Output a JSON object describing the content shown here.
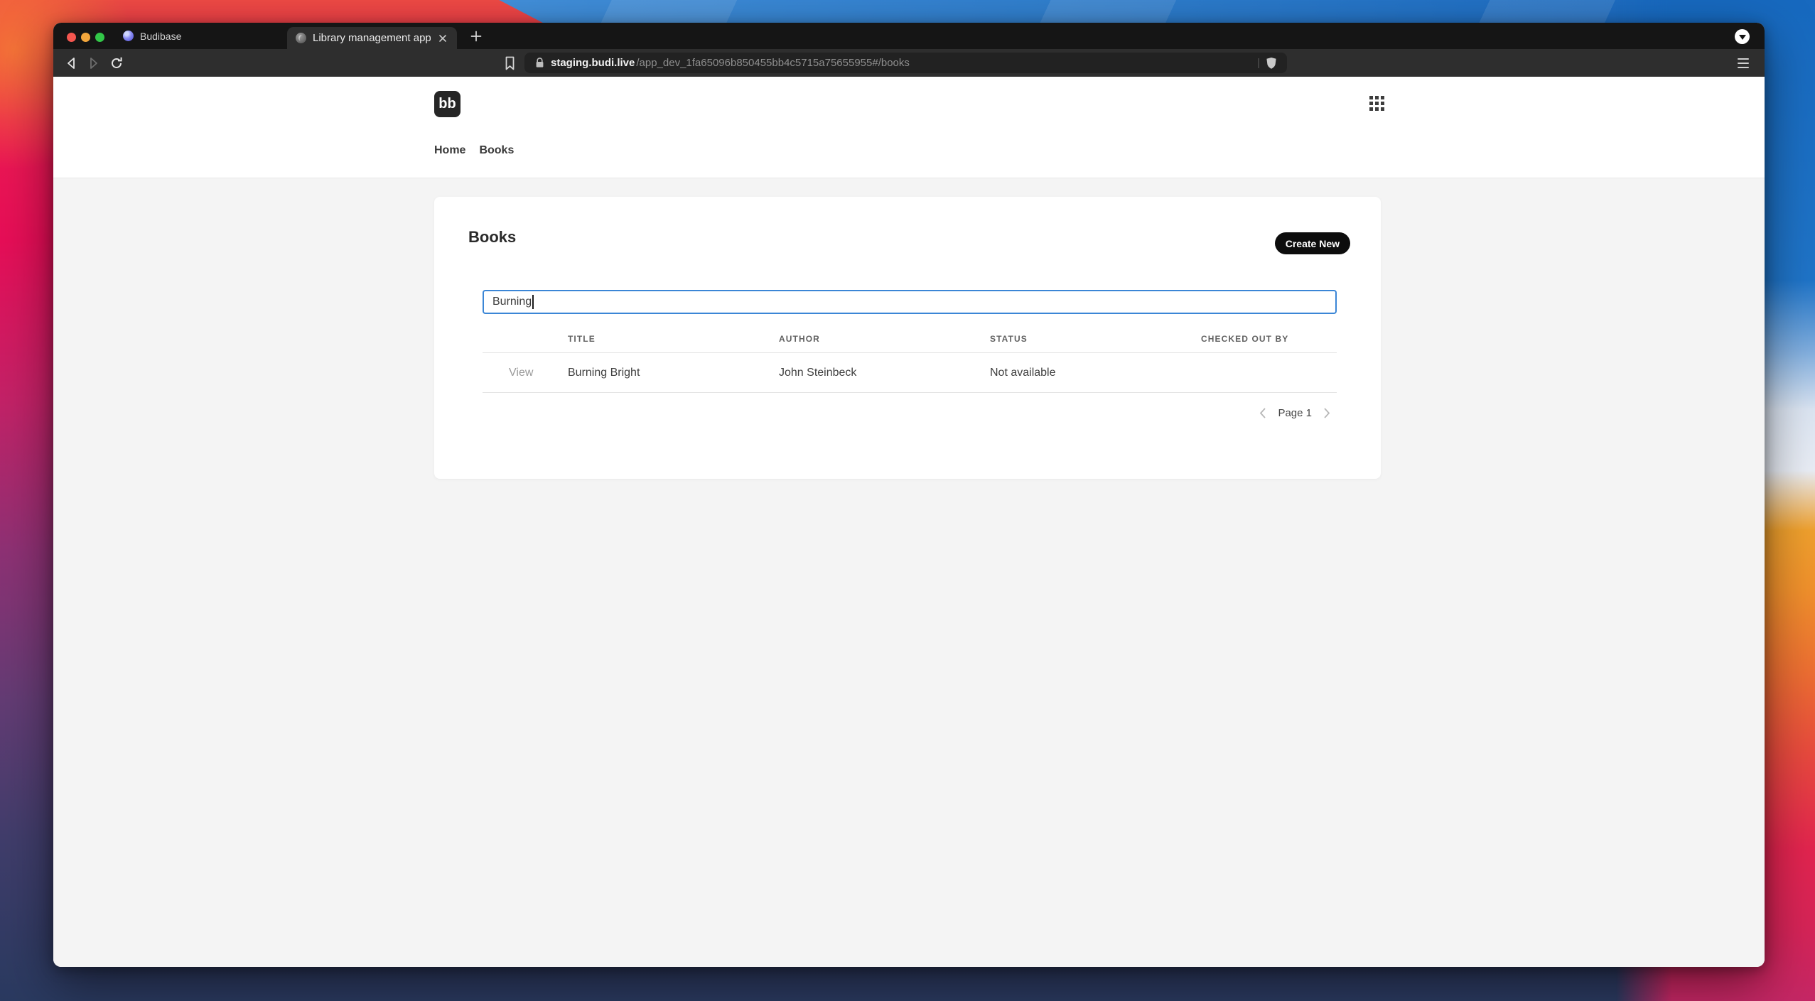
{
  "browser": {
    "tabs": [
      {
        "title": "Budibase"
      },
      {
        "title": "Library management app"
      }
    ],
    "url": {
      "domain": "staging.budi.live",
      "path": "/app_dev_1fa65096b850455bb4c5715a75655955#/books"
    }
  },
  "app": {
    "logo": "bb",
    "nav": [
      {
        "label": "Home"
      },
      {
        "label": "Books"
      }
    ],
    "books_page": {
      "title": "Books",
      "create_button": "Create New",
      "search": {
        "value": "Burning"
      },
      "table": {
        "headers": {
          "title": "TITLE",
          "author": "AUTHOR",
          "status": "STATUS",
          "checked_out_by": "CHECKED OUT BY"
        },
        "rows": [
          {
            "action": "View",
            "title": "Burning Bright",
            "author": "John Steinbeck",
            "status": "Not available",
            "checked_out_by": ""
          }
        ]
      },
      "pagination": {
        "page_label": "Page 1"
      }
    }
  },
  "colors": {
    "accent_blue": "#3b86d6",
    "button_bg": "#0d0d0d",
    "page_gray": "#f4f4f4",
    "card_white": "#ffffff"
  }
}
